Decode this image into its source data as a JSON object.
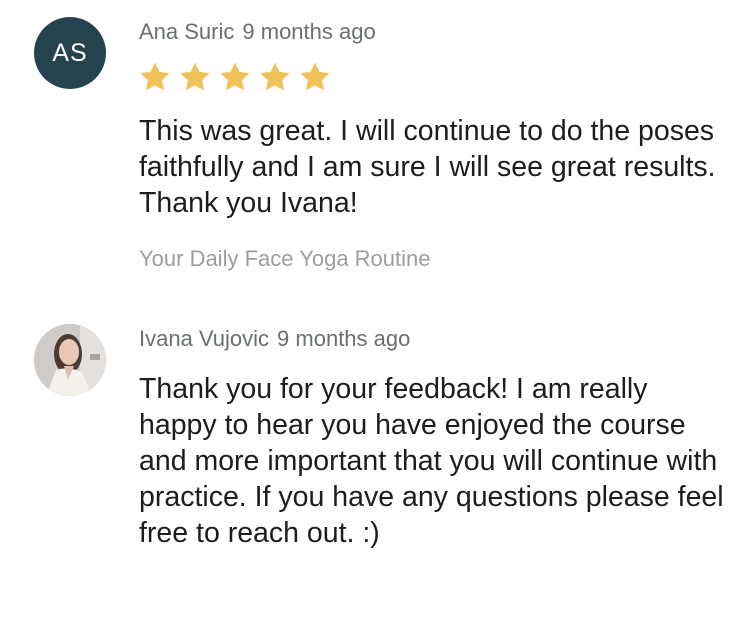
{
  "reviews": [
    {
      "avatar_initials": "AS",
      "avatar_color": "#24434f",
      "author": "Ana Suric",
      "time": "9 months ago",
      "rating": 5,
      "star_color": "#f0c159",
      "text": "This was great. I will continue to do the poses faithfully and I am sure I will see great results. Thank you Ivana!",
      "course": "Your Daily Face Yoga Routine"
    },
    {
      "author": "Ivana Vujovic",
      "time": "9 months ago",
      "text": "Thank you for your feedback! I am really happy to hear you have enjoyed the course and more important that you will continue with practice. If you have any questions please feel free to reach out. :)"
    }
  ]
}
